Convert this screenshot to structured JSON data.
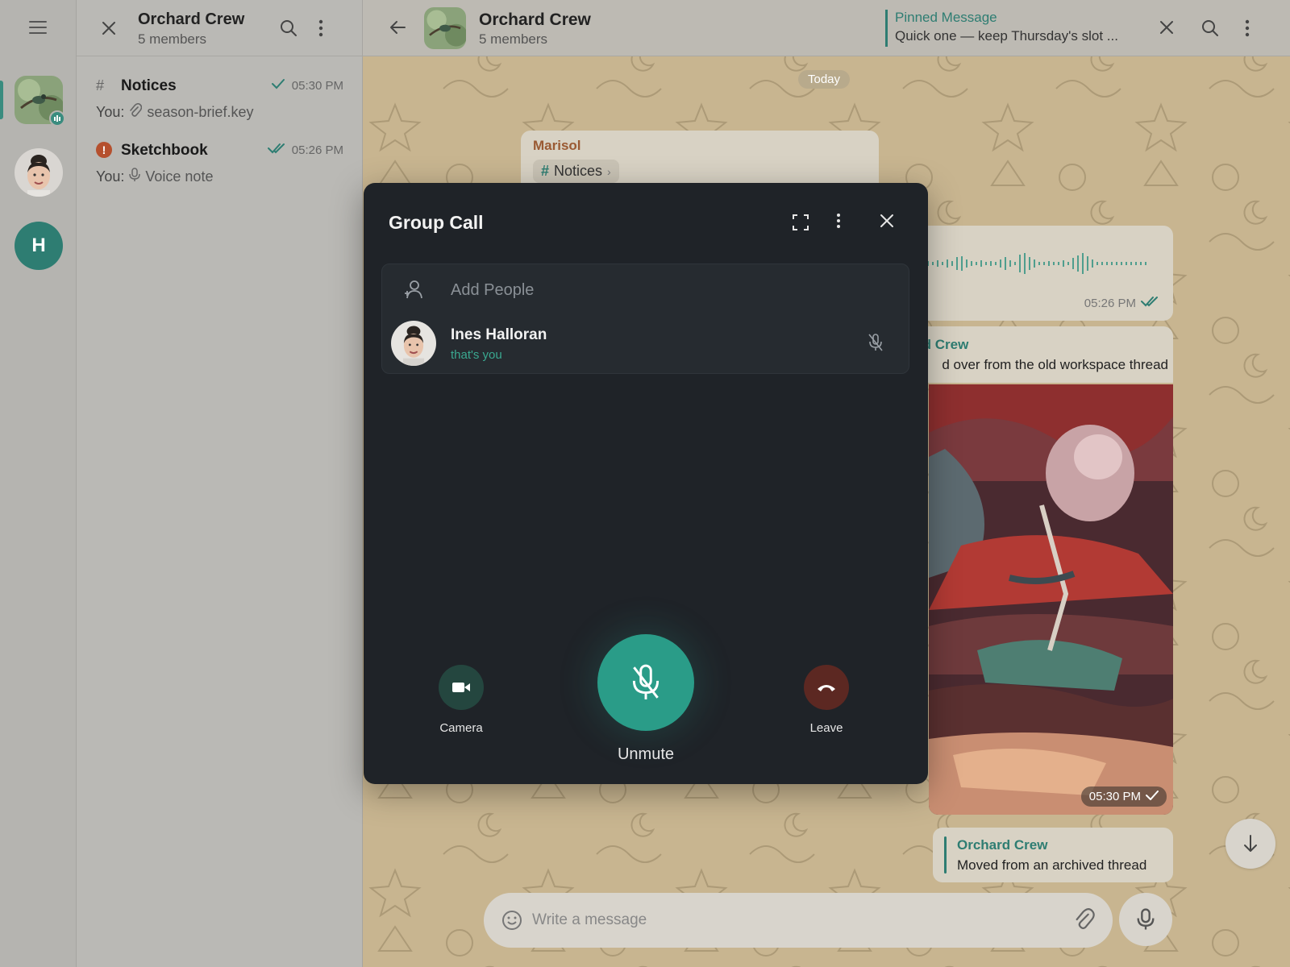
{
  "rail": {
    "avatar_initial": "H"
  },
  "chat_list": {
    "title": "Orchard Crew",
    "subtitle": "5 members",
    "items": [
      {
        "name": "Notices",
        "time": "05:30 PM",
        "you": "You:",
        "preview": "season-brief.key",
        "icon": "hash-icon"
      },
      {
        "name": "Sketchbook",
        "time": "05:26 PM",
        "you": "You:",
        "preview": "Voice note",
        "icon": "error-icon",
        "err": "!"
      }
    ]
  },
  "main_header": {
    "title": "Orchard Crew",
    "subtitle": "5 members",
    "pinned_label": "Pinned Message",
    "pinned_text": "Quick one — keep Thursday's slot ..."
  },
  "messages": {
    "date_chip": "Today",
    "marisol_sender": "Marisol",
    "marisol_topic": "Notices",
    "voice_time": "05:26 PM",
    "forward_name": "rd Crew",
    "forward_text": "d over from the old workspace thread",
    "photo_time": "05:30 PM",
    "archived_name": "Orchard Crew",
    "archived_text": "Moved from an archived thread"
  },
  "composer": {
    "placeholder": "Write a message"
  },
  "call": {
    "title": "Group Call",
    "add_people": "Add People",
    "participant_name": "Ines Halloran",
    "participant_sub": "that's you",
    "camera_label": "Camera",
    "unmute_label": "Unmute",
    "leave_label": "Leave"
  },
  "colors": {
    "accent": "#2e7d72",
    "call_bg": "#1f2328",
    "unmute": "#2a9c88",
    "leave": "#5c2822",
    "wallpaper": "#c8b590"
  }
}
